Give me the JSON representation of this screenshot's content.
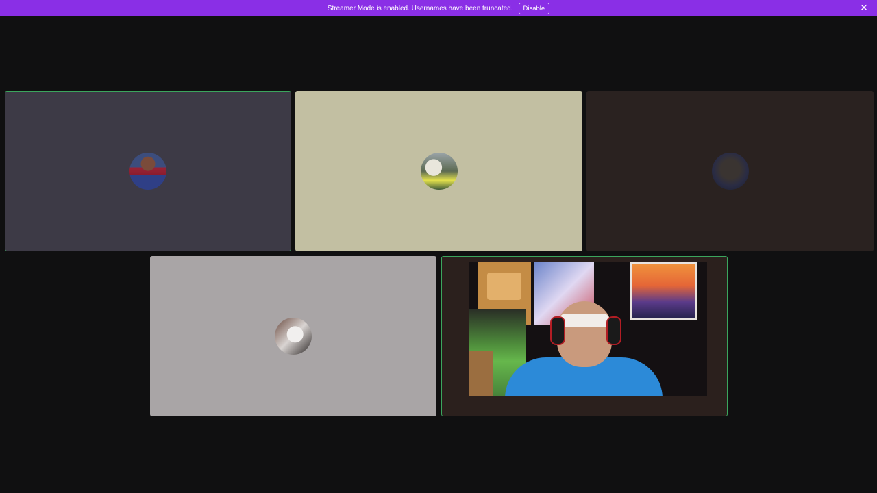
{
  "banner": {
    "text": "Streamer Mode is enabled. Usernames have been truncated.",
    "disable_label": "Disable",
    "close_icon": "close-icon",
    "background": "#8a2fe6"
  },
  "tiles": [
    {
      "id": "tile1",
      "type": "avatar",
      "speaking": true,
      "background": "#3d3a46"
    },
    {
      "id": "tile2",
      "type": "avatar",
      "speaking": false,
      "background": "#c2bfa2"
    },
    {
      "id": "tile3",
      "type": "avatar",
      "speaking": false,
      "background": "#2a2220"
    },
    {
      "id": "tile4",
      "type": "avatar",
      "speaking": false,
      "background": "#a9a5a6"
    },
    {
      "id": "tile5",
      "type": "video",
      "speaking": true,
      "background": "#2b201d"
    }
  ],
  "colors": {
    "speaking_border": "#3ba55d",
    "app_background": "#101011"
  }
}
